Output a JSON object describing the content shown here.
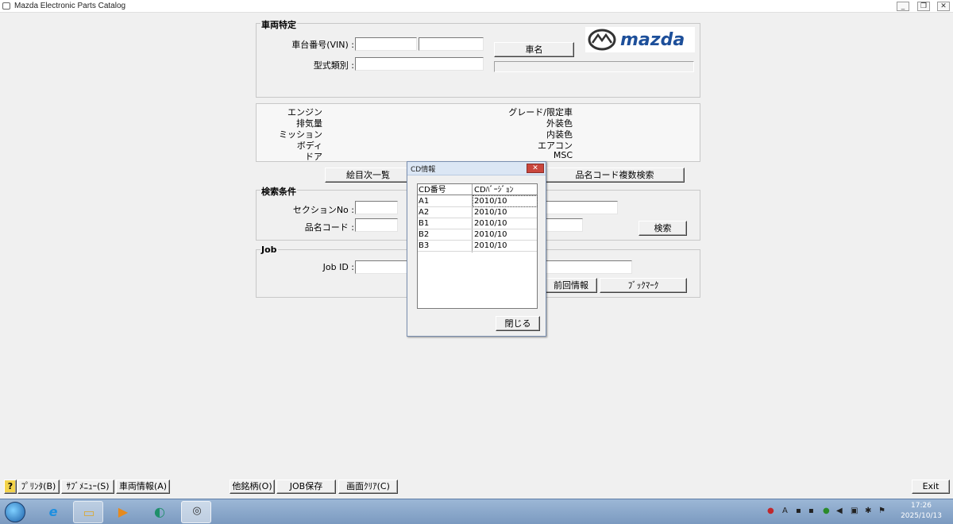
{
  "window": {
    "title": "Mazda Electronic Parts Catalog",
    "minimize": "_",
    "restore": "❐",
    "close": "✕"
  },
  "vehicle_id": {
    "group_label": "車両特定",
    "vin_label": "車台番号(VIN) :",
    "vin_part1": "",
    "vin_part2": "",
    "model_type_label": "型式類別 :",
    "model_type_value": "",
    "car_name_button": "車名"
  },
  "logo": {
    "brand_text": "mazda"
  },
  "vehicle_info": {
    "left_labels": [
      "エンジン",
      "排気量",
      "ミッション",
      "ボディ",
      "ドア"
    ],
    "right_labels": [
      "グレード/限定車",
      "外装色",
      "内装色",
      "エアコン",
      "MSC"
    ]
  },
  "buttons_row": {
    "illustration_index": "絵目次一覧",
    "multi_part_search": "品名コード複数検索"
  },
  "search": {
    "group_label": "検索条件",
    "section_label": "セクションNo :",
    "part_code_label": "品名コード :",
    "search_button": "検索"
  },
  "job": {
    "group_label": "Job",
    "job_id_label": "Job ID :",
    "prev_info_button": "前回情報",
    "bookmark_button": "ﾌﾞｯｸﾏｰｸ"
  },
  "cd_dialog": {
    "title": "CD情報",
    "col_cd": "CD番号",
    "col_version": "CDﾊﾞｰｼﾞｮﾝ",
    "rows": [
      {
        "cd": "A1",
        "version": "2010/10"
      },
      {
        "cd": "A2",
        "version": "2010/10"
      },
      {
        "cd": "B1",
        "version": "2010/10"
      },
      {
        "cd": "B2",
        "version": "2010/10"
      },
      {
        "cd": "B3",
        "version": "2010/10"
      }
    ],
    "close_button": "閉じる"
  },
  "bottom_bar": {
    "help": "?",
    "print": "ﾌﾟﾘﾝﾀ(B)",
    "submenu": "ｻﾌﾞﾒﾆｭｰ(S)",
    "vehicle_info": "車両情報(A)",
    "other_brand": "他銘柄(O)",
    "job_save": "JOB保存",
    "screen_clear": "画面ｸﾘｱ(C)",
    "exit": "Exit"
  },
  "taskbar": {
    "time": "17:26",
    "date": "2025/10/13",
    "apps": [
      "internet-explorer",
      "file-explorer",
      "media-player",
      "edge",
      "mazda-epc"
    ]
  }
}
